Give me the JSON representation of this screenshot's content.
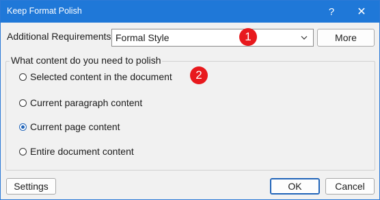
{
  "window": {
    "title": "Keep Format Polish",
    "help_glyph": "?",
    "close_glyph": "✕"
  },
  "requirements": {
    "label": "Additional Requirements",
    "selected_value": "Formal Style",
    "more_label": "More"
  },
  "badges": {
    "first": "1",
    "second": "2"
  },
  "content_group": {
    "legend": "What content do you need to polish",
    "options": [
      {
        "label": "Selected content in the document",
        "checked": false
      },
      {
        "label": "Current paragraph content",
        "checked": false
      },
      {
        "label": "Current page content",
        "checked": true
      },
      {
        "label": "Entire document content",
        "checked": false
      }
    ]
  },
  "footer": {
    "settings_label": "Settings",
    "ok_label": "OK",
    "cancel_label": "Cancel"
  },
  "colors": {
    "titlebar": "#1f78d8",
    "badge": "#e8191d",
    "radio_checked": "#1f63b8"
  },
  "icons": {
    "help": "help-icon",
    "close": "close-icon",
    "dropdown": "chevron-down-icon"
  }
}
